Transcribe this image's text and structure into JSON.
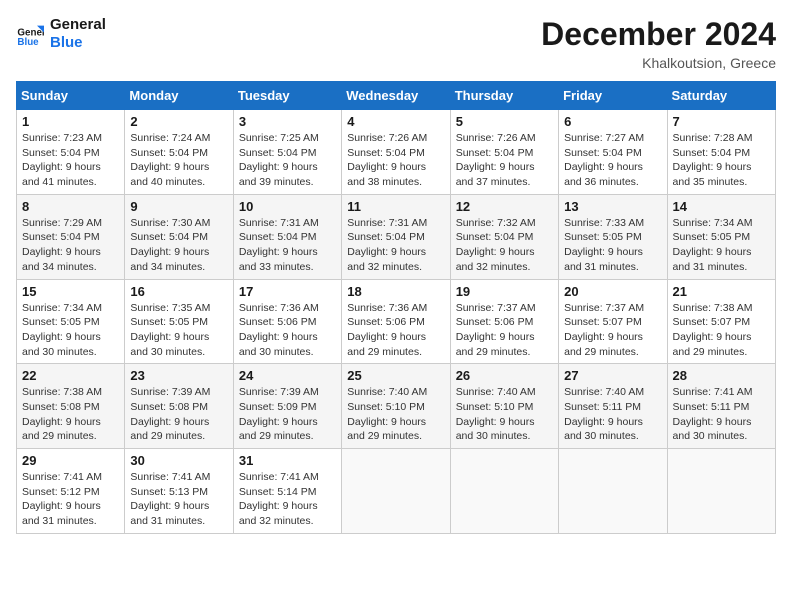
{
  "header": {
    "logo_line1": "General",
    "logo_line2": "Blue",
    "main_title": "December 2024",
    "subtitle": "Khalkoutsion, Greece"
  },
  "calendar": {
    "days_of_week": [
      "Sunday",
      "Monday",
      "Tuesday",
      "Wednesday",
      "Thursday",
      "Friday",
      "Saturday"
    ],
    "weeks": [
      [
        {
          "day": "",
          "empty": true
        },
        {
          "day": "",
          "empty": true
        },
        {
          "day": "",
          "empty": true
        },
        {
          "day": "",
          "empty": true
        },
        {
          "day": "",
          "empty": true
        },
        {
          "day": "",
          "empty": true
        },
        {
          "day": "",
          "empty": true
        }
      ],
      [
        {
          "day": "1",
          "sunrise": "7:23 AM",
          "sunset": "5:04 PM",
          "daylight": "9 hours and 41 minutes."
        },
        {
          "day": "2",
          "sunrise": "7:24 AM",
          "sunset": "5:04 PM",
          "daylight": "9 hours and 40 minutes."
        },
        {
          "day": "3",
          "sunrise": "7:25 AM",
          "sunset": "5:04 PM",
          "daylight": "9 hours and 39 minutes."
        },
        {
          "day": "4",
          "sunrise": "7:26 AM",
          "sunset": "5:04 PM",
          "daylight": "9 hours and 38 minutes."
        },
        {
          "day": "5",
          "sunrise": "7:26 AM",
          "sunset": "5:04 PM",
          "daylight": "9 hours and 37 minutes."
        },
        {
          "day": "6",
          "sunrise": "7:27 AM",
          "sunset": "5:04 PM",
          "daylight": "9 hours and 36 minutes."
        },
        {
          "day": "7",
          "sunrise": "7:28 AM",
          "sunset": "5:04 PM",
          "daylight": "9 hours and 35 minutes."
        }
      ],
      [
        {
          "day": "8",
          "sunrise": "7:29 AM",
          "sunset": "5:04 PM",
          "daylight": "9 hours and 34 minutes."
        },
        {
          "day": "9",
          "sunrise": "7:30 AM",
          "sunset": "5:04 PM",
          "daylight": "9 hours and 34 minutes."
        },
        {
          "day": "10",
          "sunrise": "7:31 AM",
          "sunset": "5:04 PM",
          "daylight": "9 hours and 33 minutes."
        },
        {
          "day": "11",
          "sunrise": "7:31 AM",
          "sunset": "5:04 PM",
          "daylight": "9 hours and 32 minutes."
        },
        {
          "day": "12",
          "sunrise": "7:32 AM",
          "sunset": "5:04 PM",
          "daylight": "9 hours and 32 minutes."
        },
        {
          "day": "13",
          "sunrise": "7:33 AM",
          "sunset": "5:05 PM",
          "daylight": "9 hours and 31 minutes."
        },
        {
          "day": "14",
          "sunrise": "7:34 AM",
          "sunset": "5:05 PM",
          "daylight": "9 hours and 31 minutes."
        }
      ],
      [
        {
          "day": "15",
          "sunrise": "7:34 AM",
          "sunset": "5:05 PM",
          "daylight": "9 hours and 30 minutes."
        },
        {
          "day": "16",
          "sunrise": "7:35 AM",
          "sunset": "5:05 PM",
          "daylight": "9 hours and 30 minutes."
        },
        {
          "day": "17",
          "sunrise": "7:36 AM",
          "sunset": "5:06 PM",
          "daylight": "9 hours and 30 minutes."
        },
        {
          "day": "18",
          "sunrise": "7:36 AM",
          "sunset": "5:06 PM",
          "daylight": "9 hours and 29 minutes."
        },
        {
          "day": "19",
          "sunrise": "7:37 AM",
          "sunset": "5:06 PM",
          "daylight": "9 hours and 29 minutes."
        },
        {
          "day": "20",
          "sunrise": "7:37 AM",
          "sunset": "5:07 PM",
          "daylight": "9 hours and 29 minutes."
        },
        {
          "day": "21",
          "sunrise": "7:38 AM",
          "sunset": "5:07 PM",
          "daylight": "9 hours and 29 minutes."
        }
      ],
      [
        {
          "day": "22",
          "sunrise": "7:38 AM",
          "sunset": "5:08 PM",
          "daylight": "9 hours and 29 minutes."
        },
        {
          "day": "23",
          "sunrise": "7:39 AM",
          "sunset": "5:08 PM",
          "daylight": "9 hours and 29 minutes."
        },
        {
          "day": "24",
          "sunrise": "7:39 AM",
          "sunset": "5:09 PM",
          "daylight": "9 hours and 29 minutes."
        },
        {
          "day": "25",
          "sunrise": "7:40 AM",
          "sunset": "5:10 PM",
          "daylight": "9 hours and 29 minutes."
        },
        {
          "day": "26",
          "sunrise": "7:40 AM",
          "sunset": "5:10 PM",
          "daylight": "9 hours and 30 minutes."
        },
        {
          "day": "27",
          "sunrise": "7:40 AM",
          "sunset": "5:11 PM",
          "daylight": "9 hours and 30 minutes."
        },
        {
          "day": "28",
          "sunrise": "7:41 AM",
          "sunset": "5:11 PM",
          "daylight": "9 hours and 30 minutes."
        }
      ],
      [
        {
          "day": "29",
          "sunrise": "7:41 AM",
          "sunset": "5:12 PM",
          "daylight": "9 hours and 31 minutes."
        },
        {
          "day": "30",
          "sunrise": "7:41 AM",
          "sunset": "5:13 PM",
          "daylight": "9 hours and 31 minutes."
        },
        {
          "day": "31",
          "sunrise": "7:41 AM",
          "sunset": "5:14 PM",
          "daylight": "9 hours and 32 minutes."
        },
        {
          "day": "",
          "empty": true
        },
        {
          "day": "",
          "empty": true
        },
        {
          "day": "",
          "empty": true
        },
        {
          "day": "",
          "empty": true
        }
      ]
    ]
  }
}
